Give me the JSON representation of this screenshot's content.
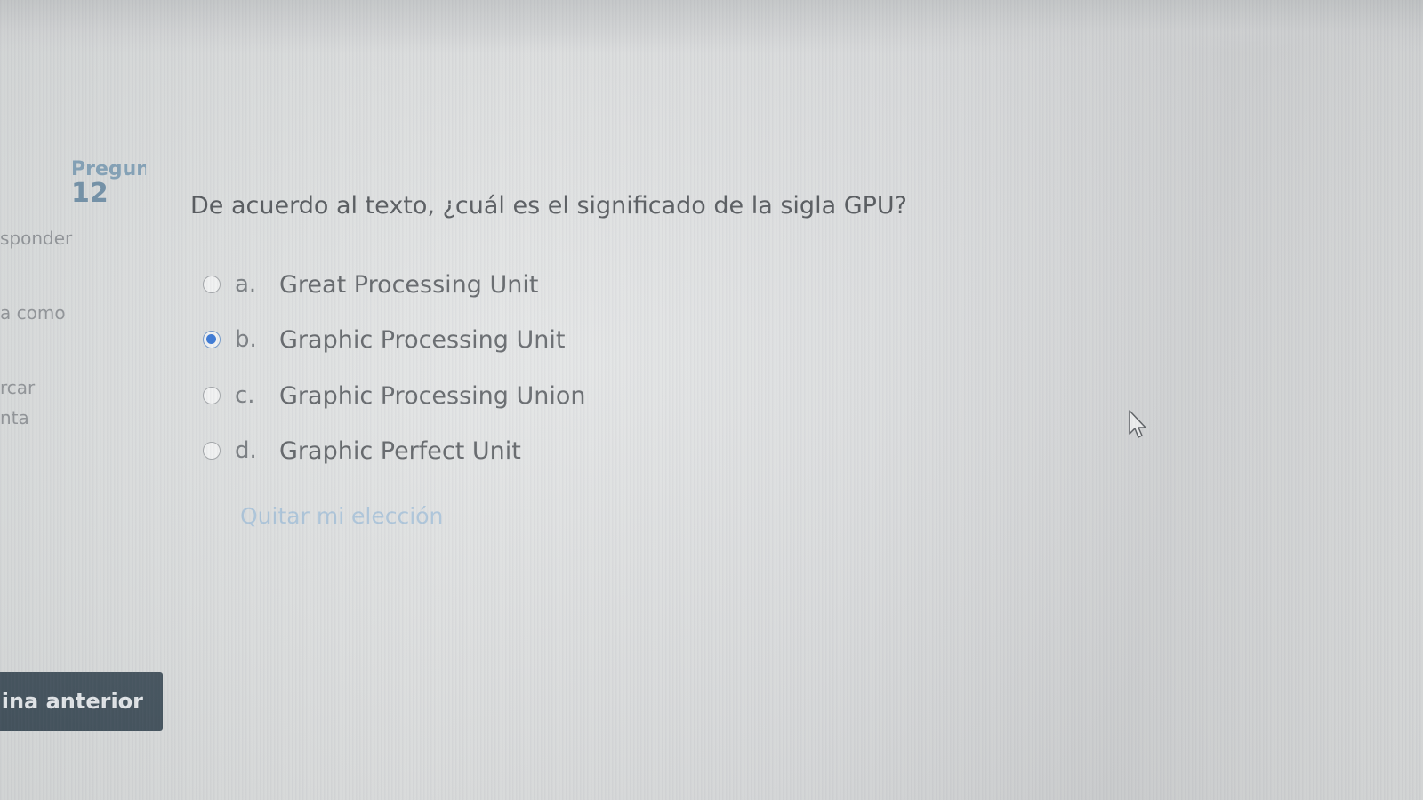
{
  "question_info": {
    "label": "Pregun",
    "number": "12",
    "status": "sponder",
    "flag_hint": "a como",
    "flag_line1": "rcar",
    "flag_line2": "nta"
  },
  "question": {
    "text": "De acuerdo al texto, ¿cuál es el significado de la sigla GPU?"
  },
  "answers": [
    {
      "letter": "a.",
      "label": "Great Processing Unit",
      "selected": false
    },
    {
      "letter": "b.",
      "label": "Graphic Processing Unit",
      "selected": true
    },
    {
      "letter": "c.",
      "label": "Graphic Processing Union",
      "selected": false
    },
    {
      "letter": "d.",
      "label": "Graphic Perfect Unit",
      "selected": false
    }
  ],
  "clear_choice_label": "Quitar mi elección",
  "navigation": {
    "previous_label": "ina anterior"
  },
  "colors": {
    "accent": "#2a6fd6",
    "button_bg": "#3f4f5a",
    "link": "#a9c4db"
  },
  "icons": {
    "cursor": "mouse-pointer-icon"
  }
}
